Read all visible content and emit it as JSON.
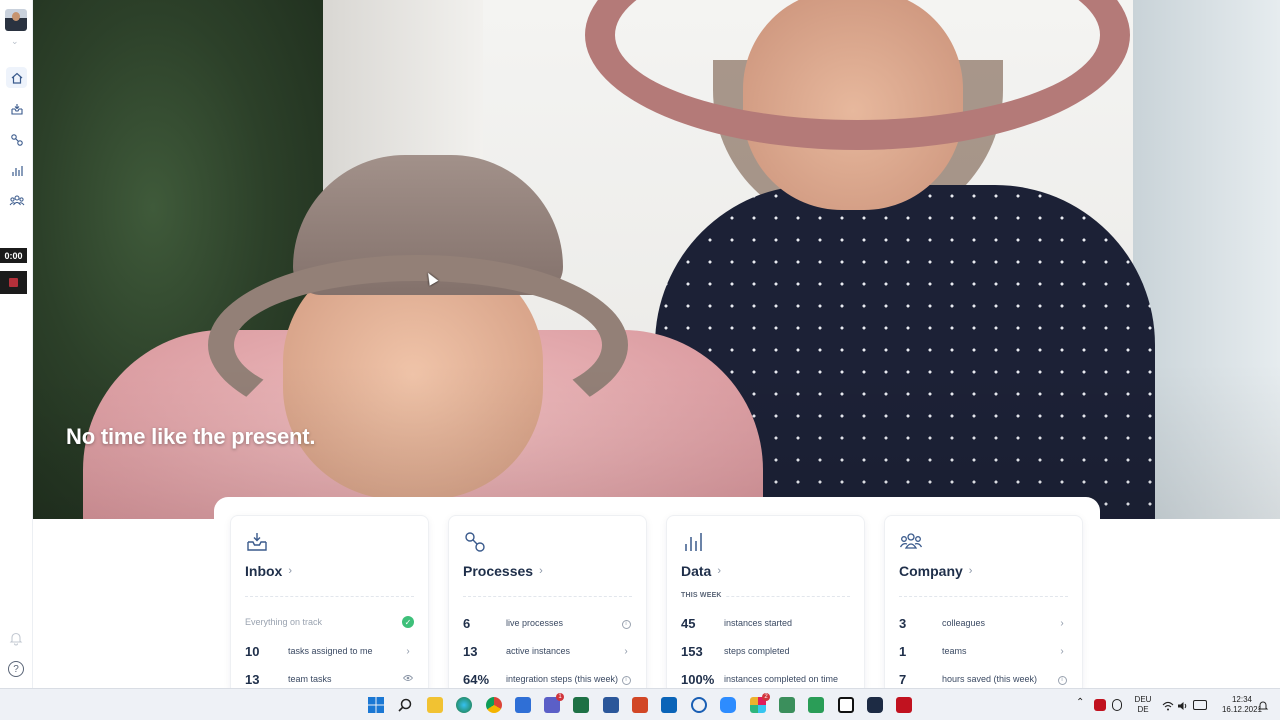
{
  "rail": {
    "timer": "0:00",
    "nav": [
      "home-icon",
      "inbox-icon",
      "processes-icon",
      "data-icon",
      "company-icon"
    ]
  },
  "hero": {
    "headline": "No time like the present."
  },
  "cards": {
    "inbox": {
      "title": "Inbox",
      "status": "Everything on track",
      "rows": [
        {
          "num": "10",
          "label": "tasks assigned to me"
        },
        {
          "num": "13",
          "label": "team tasks"
        }
      ]
    },
    "processes": {
      "title": "Processes",
      "rows": [
        {
          "num": "6",
          "label": "live processes"
        },
        {
          "num": "13",
          "label": "active instances"
        },
        {
          "num": "64%",
          "label": "integration steps (this week)"
        }
      ]
    },
    "data": {
      "title": "Data",
      "subtitle": "THIS WEEK",
      "rows": [
        {
          "num": "45",
          "label": "instances started"
        },
        {
          "num": "153",
          "label": "steps completed"
        },
        {
          "num": "100%",
          "label": "instances completed on time"
        }
      ]
    },
    "company": {
      "title": "Company",
      "rows": [
        {
          "num": "3",
          "label": "colleagues"
        },
        {
          "num": "1",
          "label": "teams"
        },
        {
          "num": "7",
          "label": "hours saved (this week)"
        }
      ]
    }
  },
  "taskbar": {
    "lang_top": "DEU",
    "lang_bottom": "DE",
    "time": "12:34",
    "date": "16.12.2021",
    "teams_badge": "1",
    "slack_badge": "2"
  },
  "colors": {
    "accent": "#1f2f4a",
    "success": "#3ec07a",
    "icon": "#3a5a8c"
  }
}
